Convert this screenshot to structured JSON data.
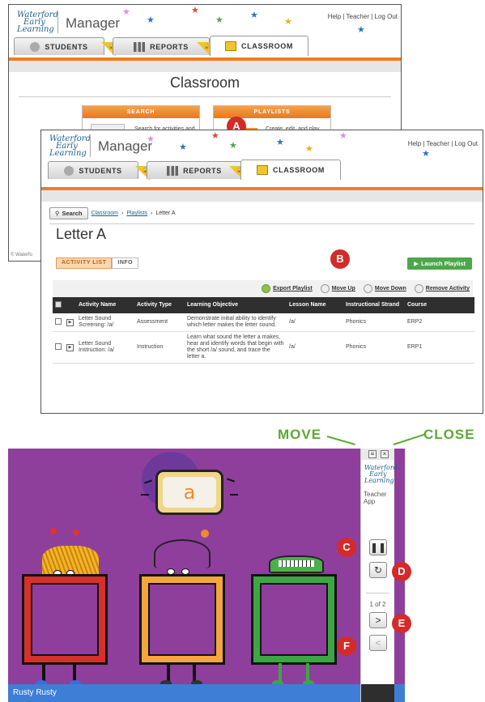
{
  "brand": {
    "logo_line1": "Waterford",
    "logo_line2": "Early",
    "logo_line3": "Learning",
    "app_name": "Manager"
  },
  "top_links": [
    "Help",
    "Teacher",
    "Log Out"
  ],
  "tabs": [
    {
      "label": "STUDENTS"
    },
    {
      "label": "REPORTS"
    },
    {
      "label": "CLASSROOM"
    }
  ],
  "back_window": {
    "heading": "Classroom",
    "search_card": {
      "title": "SEARCH",
      "text": "Search for activities and lessons."
    },
    "playlists_card": {
      "title": "PLAYLISTS",
      "text": "Create, edit, and play activity playlists."
    },
    "copyright": "© Waterfo"
  },
  "front_window": {
    "search_button": "Search",
    "breadcrumb": [
      "Classroom",
      "Playlists",
      "Letter A"
    ],
    "title": "Letter A",
    "subtabs": [
      "ACTIVITY LIST",
      "INFO"
    ],
    "launch_label": "Launch Playlist",
    "tools": [
      "Export Playlist",
      "Move Up",
      "Move Down",
      "Remove Activity"
    ],
    "columns": [
      "Activity Name",
      "Activity Type",
      "Learning Objective",
      "Lesson Name",
      "Instructional Strand",
      "Course"
    ],
    "rows": [
      {
        "name": "Letter Sound Screening: /a/",
        "type": "Assessment",
        "objective": "Demonstrate initial ability to identify which letter makes the letter sound.",
        "lesson": "/a/",
        "strand": "Phonics",
        "course": "ERP2"
      },
      {
        "name": "Letter Sound Instruction: /a/",
        "type": "Instruction",
        "objective": "Learn what sound the letter a makes, hear and identify words that begin with the short /a/ sound, and trace the letter a.",
        "lesson": "/a/",
        "strand": "Phonics",
        "course": "ERP1"
      }
    ]
  },
  "badges": {
    "a": "A",
    "b": "B",
    "c": "C",
    "d": "D",
    "e": "E",
    "f": "F"
  },
  "player": {
    "move_label": "MOVE",
    "close_label": "CLOSE",
    "sign_letter": "a",
    "panel_logo_line1": "Waterford",
    "panel_logo_line2": "Early",
    "panel_logo_line3": "Learning",
    "panel_app_line1": "Teacher",
    "panel_app_line2": "App",
    "page_count": "1 of 2",
    "status_text": "Rusty Rusty"
  },
  "colors": {
    "orange": "#ef7d22",
    "green": "#5aaa32",
    "purple": "#8e3f9c",
    "badge_red": "#d42a2a",
    "status_blue": "#3f7ed6"
  }
}
